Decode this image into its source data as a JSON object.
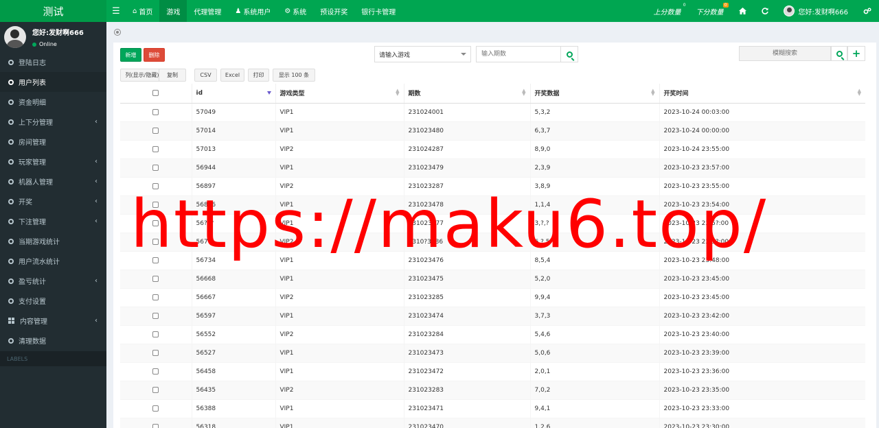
{
  "app": {
    "title": "测试"
  },
  "topnav": {
    "items": [
      {
        "label": "首页",
        "icon": "home-icon",
        "active": false
      },
      {
        "label": "游戏",
        "icon": "",
        "active": true
      },
      {
        "label": "代理管理",
        "icon": "",
        "active": false
      },
      {
        "label": "系统用户",
        "icon": "user-icon",
        "active": false
      },
      {
        "label": "系统",
        "icon": "gear-icon",
        "active": false
      },
      {
        "label": "预设开奖",
        "icon": "",
        "active": false
      },
      {
        "label": "银行卡管理",
        "icon": "",
        "active": false
      }
    ],
    "up_score": {
      "label": "上分数量",
      "count": "0"
    },
    "down_score": {
      "label": "下分数量",
      "count": "0"
    },
    "user_greeting": "您好:发财啊666"
  },
  "sidebar": {
    "user": {
      "name": "您好:发财啊666",
      "status": "Online"
    },
    "items": [
      {
        "label": "登陆日志",
        "chevron": false,
        "active": false,
        "icon": "circle-icon"
      },
      {
        "label": "用户列表",
        "chevron": false,
        "active": true,
        "icon": "circle-icon"
      },
      {
        "label": "资金明细",
        "chevron": false,
        "active": false,
        "icon": "circle-icon"
      },
      {
        "label": "上下分管理",
        "chevron": true,
        "active": false,
        "icon": "circle-icon"
      },
      {
        "label": "房间管理",
        "chevron": false,
        "active": false,
        "icon": "circle-icon"
      },
      {
        "label": "玩家管理",
        "chevron": true,
        "active": false,
        "icon": "circle-icon"
      },
      {
        "label": "机器人管理",
        "chevron": true,
        "active": false,
        "icon": "circle-icon"
      },
      {
        "label": "开奖",
        "chevron": true,
        "active": false,
        "icon": "circle-icon"
      },
      {
        "label": "下注管理",
        "chevron": true,
        "active": false,
        "icon": "circle-icon"
      },
      {
        "label": "当期游戏统计",
        "chevron": false,
        "active": false,
        "icon": "circle-icon"
      },
      {
        "label": "用户流水统计",
        "chevron": false,
        "active": false,
        "icon": "circle-icon"
      },
      {
        "label": "盈亏统计",
        "chevron": true,
        "active": false,
        "icon": "circle-icon"
      },
      {
        "label": "支付设置",
        "chevron": false,
        "active": false,
        "icon": "circle-icon"
      },
      {
        "label": "内容管理",
        "chevron": true,
        "active": false,
        "icon": "grid-icon"
      },
      {
        "label": "清理数据",
        "chevron": false,
        "active": false,
        "icon": "circle-icon"
      }
    ],
    "labels_header": "LABELS"
  },
  "toolbar": {
    "add_label": "新增",
    "delete_label": "删除",
    "game_select_value": "请输入游戏",
    "period_placeholder": "输入期数",
    "fuzzy_search_placeholder": "模糊搜索",
    "export_buttons": [
      "列(显示/隐藏)",
      "复制",
      "CSV",
      "Excel",
      "打印",
      "显示 100 条"
    ]
  },
  "table": {
    "columns": [
      "id",
      "游戏类型",
      "期数",
      "开奖数据",
      "开奖时间"
    ],
    "rows": [
      [
        "57049",
        "VIP1",
        "231024001",
        "5,3,2",
        "2023-10-24 00:03:00"
      ],
      [
        "57014",
        "VIP1",
        "231023480",
        "6,3,7",
        "2023-10-24 00:00:00"
      ],
      [
        "57013",
        "VIP2",
        "231024287",
        "8,9,0",
        "2023-10-24 23:55:00"
      ],
      [
        "56944",
        "VIP1",
        "231023479",
        "2,3,9",
        "2023-10-23 23:57:00"
      ],
      [
        "56897",
        "VIP2",
        "231023287",
        "3,8,9",
        "2023-10-23 23:55:00"
      ],
      [
        "56876",
        "VIP1",
        "231023478",
        "1,1,4",
        "2023-10-23 23:54:00"
      ],
      [
        "56???",
        "VIP1",
        "231023477",
        "3,?,?",
        "2023-10-23 23:5?:00"
      ],
      [
        "567?1",
        "VIP2",
        "2310?3286",
        "6,?,5",
        "2023-10-23 23:5?:00"
      ],
      [
        "56734",
        "VIP1",
        "231023476",
        "8,5,4",
        "2023-10-23 23:48:00"
      ],
      [
        "56668",
        "VIP1",
        "231023475",
        "5,2,0",
        "2023-10-23 23:45:00"
      ],
      [
        "56667",
        "VIP2",
        "231023285",
        "9,9,4",
        "2023-10-23 23:45:00"
      ],
      [
        "56597",
        "VIP1",
        "231023474",
        "3,7,3",
        "2023-10-23 23:42:00"
      ],
      [
        "56552",
        "VIP2",
        "231023284",
        "5,4,6",
        "2023-10-23 23:40:00"
      ],
      [
        "56527",
        "VIP1",
        "231023473",
        "5,0,6",
        "2023-10-23 23:39:00"
      ],
      [
        "56458",
        "VIP1",
        "231023472",
        "2,0,1",
        "2023-10-23 23:36:00"
      ],
      [
        "56435",
        "VIP2",
        "231023283",
        "7,0,2",
        "2023-10-23 23:35:00"
      ],
      [
        "56388",
        "VIP1",
        "231023471",
        "9,4,1",
        "2023-10-23 23:33:00"
      ],
      [
        "56318",
        "VIP1",
        "231023470",
        "1,2,6",
        "2023-10-23 23:30:00"
      ]
    ]
  },
  "watermark": "https://maku6.top/",
  "colors": {
    "header_green": "#00a651",
    "logo_green": "#009a48",
    "sidebar_bg": "#222d32",
    "success": "#00a65a",
    "danger": "#dd4b39",
    "watermark_red": "#ff0000"
  }
}
